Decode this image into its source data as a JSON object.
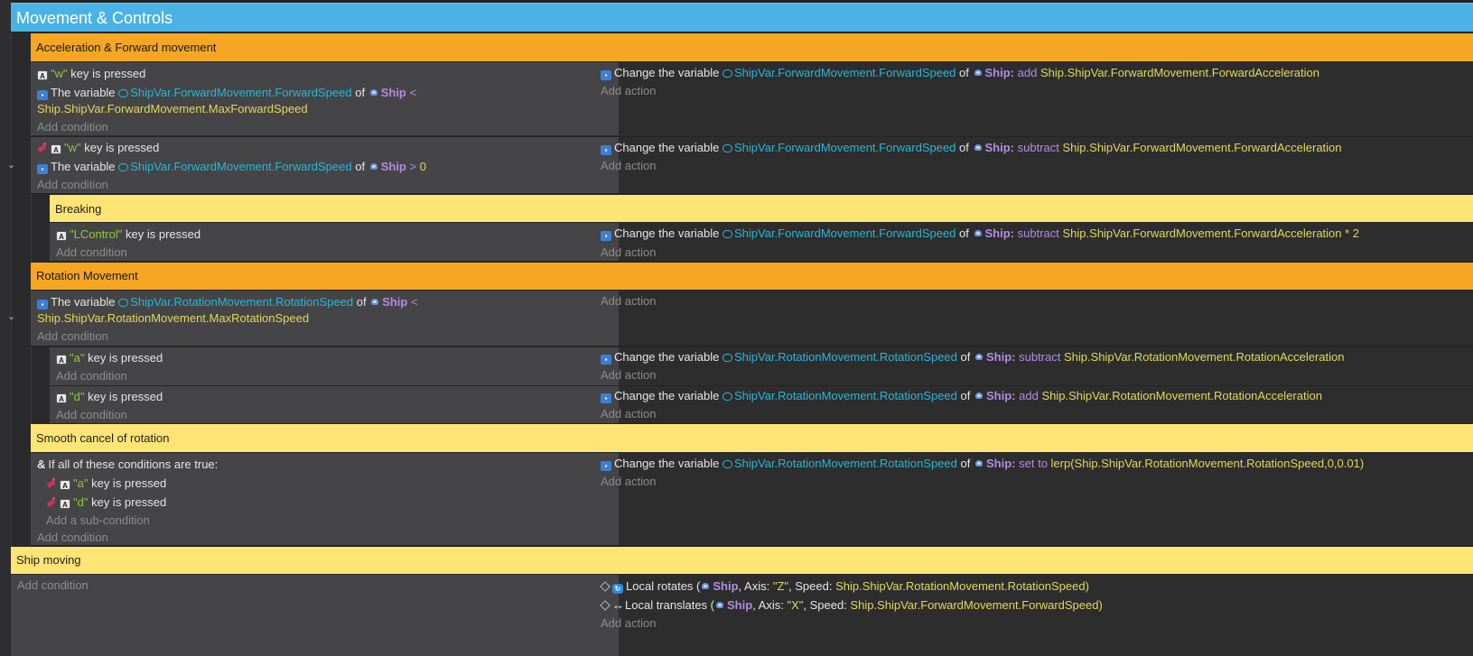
{
  "header": {
    "title": "Movement & Controls"
  },
  "icons": {
    "key": "keyboard-key-icon",
    "variable": "variable-icon",
    "object": "object-icon",
    "inverted": "inverted-condition-icon",
    "link": "object-variable-icon",
    "cube": "3d-object-icon",
    "rotate": "rotate-icon",
    "translate": "translate-arrows-icon",
    "and": "and-condition-icon",
    "chevron": "chevron-down-icon"
  },
  "colors": {
    "header": "#4ab2e4",
    "group_orange": "#f5a623",
    "comment_yellow": "#ffe476",
    "condition_bg": "#454547",
    "action_bg": "#2d2d2e",
    "cyan": "#29b6d6",
    "yellow_expr": "#e3d858",
    "purple": "#b48ce0"
  },
  "common": {
    "add_condition": "Add condition",
    "add_action": "Add action",
    "add_subcondition": "Add a sub-condition",
    "key_is_pressed": "key is pressed",
    "the_variable": "The variable",
    "change_the_variable": "Change the variable",
    "of": "of",
    "ship": "Ship",
    "ship_colon": "Ship:",
    "add": "add",
    "subtract": "subtract",
    "set_to": "set to",
    "lt": "<",
    "gt": ">",
    "if_all": "If all of these conditions are true:"
  },
  "groups": {
    "accel": "Acceleration & Forward movement",
    "breaking": "Breaking",
    "rotation": "Rotation Movement",
    "smooth": "Smooth cancel of rotation",
    "moving": "Ship moving"
  },
  "keys": {
    "w": "\"w\"",
    "lcontrol": "\"LControl\"",
    "a": "\"a\"",
    "d": "\"d\""
  },
  "vars": {
    "forward_speed": "ShipVar.ForwardMovement.ForwardSpeed",
    "max_forward": "Ship.ShipVar.ForwardMovement.MaxForwardSpeed",
    "forward_accel": "Ship.ShipVar.ForwardMovement.ForwardAcceleration",
    "forward_accel_x2": "Ship.ShipVar.ForwardMovement.ForwardAcceleration * 2",
    "rotation_speed": "ShipVar.RotationMovement.RotationSpeed",
    "max_rotation": "Ship.ShipVar.RotationMovement.MaxRotationSpeed",
    "rotation_accel": "Ship.ShipVar.RotationMovement.RotationAcceleration",
    "zero": "0",
    "lerp_expr": "lerp(Ship.ShipVar.RotationMovement.RotationSpeed,0,0.01)",
    "rot_speed_expr": "Ship.ShipVar.RotationMovement.RotationSpeed)",
    "fwd_speed_expr": "Ship.ShipVar.ForwardMovement.ForwardSpeed)"
  },
  "moving": {
    "local_rotates_open": "Local rotates (",
    "local_translates_open": "Local translates (",
    "axis_label": ", Axis: ",
    "axis_z": "\"Z\"",
    "axis_x": "\"X\"",
    "speed_label": ", Speed: "
  }
}
